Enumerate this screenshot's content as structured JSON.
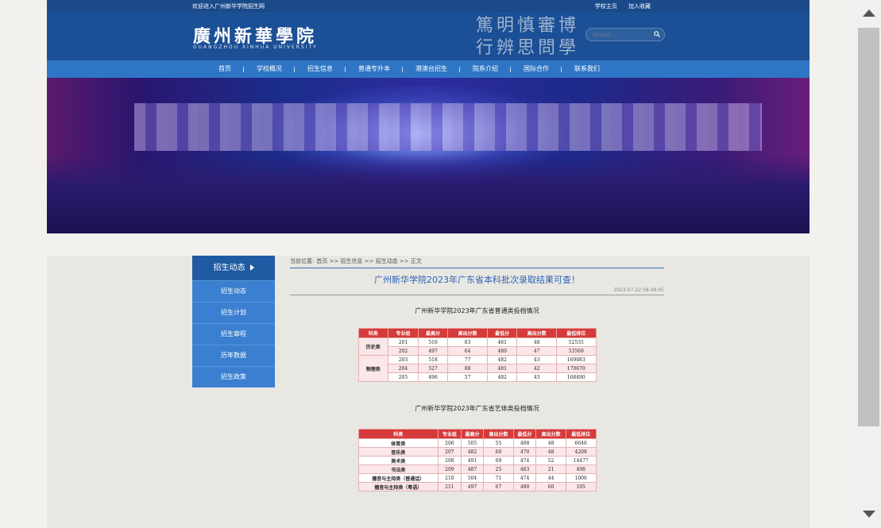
{
  "topbar": {
    "welcome": "欢迎进入广州新华学院招生网",
    "links": [
      "学校主页",
      "加入收藏"
    ]
  },
  "header": {
    "logo_cn": "廣州新華學院",
    "logo_en": "GUANGZHOU XINHUA UNIVERSITY",
    "motto_line1": "篤明慎審博",
    "motto_line2": "行辨思問學",
    "search_placeholder": "Search..."
  },
  "nav": {
    "items": [
      "首页",
      "学校概况",
      "招生信息",
      "普通专升本",
      "港澳台招生",
      "院系介绍",
      "国际合作",
      "联系我们"
    ]
  },
  "sidebar": {
    "heading": "招生动态",
    "items": [
      "招生动态",
      "招生计划",
      "招生章程",
      "历年数据",
      "招生政策"
    ]
  },
  "breadcrumb": {
    "label": "当前位置:",
    "path": "首页 >> 招生信息 >> 招生动态 >> 正文"
  },
  "article": {
    "title": "广州新华学院2023年广东省本科批次录取结果可查！",
    "date": "2023-07-22 08:48:45"
  },
  "table1": {
    "caption": "广州新华学院2023年广东省普通类投档情况",
    "headers": [
      "科类",
      "专业组",
      "最高分",
      "高出分数",
      "最低分",
      "高出分数",
      "最低排位"
    ],
    "groups": [
      {
        "name": "历史类",
        "rows": [
          [
            "201",
            "516",
            "83",
            "481",
            "48",
            "52535"
          ],
          [
            "202",
            "497",
            "64",
            "480",
            "47",
            "53569"
          ]
        ]
      },
      {
        "name": "物理类",
        "rows": [
          [
            "203",
            "518",
            "77",
            "482",
            "43",
            "169083"
          ],
          [
            "204",
            "527",
            "88",
            "481",
            "42",
            "170670"
          ],
          [
            "205",
            "496",
            "57",
            "482",
            "43",
            "168490"
          ]
        ]
      }
    ]
  },
  "table2": {
    "caption": "广州新华学院2023年广东省艺体类投档情况",
    "headers": [
      "科类",
      "专业组",
      "最高分",
      "高出分数",
      "最低分",
      "高出分数",
      "最低排位"
    ],
    "rows": [
      [
        "体育类",
        "206",
        "505",
        "55",
        "498",
        "48",
        "6646"
      ],
      [
        "音乐类",
        "207",
        "482",
        "60",
        "470",
        "48",
        "4208"
      ],
      [
        "美术类",
        "208",
        "491",
        "69",
        "474",
        "52",
        "14477"
      ],
      [
        "书法类",
        "209",
        "487",
        "25",
        "483",
        "21",
        "498"
      ],
      [
        "播音与主持类（普通话）",
        "210",
        "504",
        "71",
        "474",
        "44",
        "1006"
      ],
      [
        "播音与主持类（粤语）",
        "211",
        "497",
        "67",
        "490",
        "60",
        "105"
      ]
    ]
  }
}
